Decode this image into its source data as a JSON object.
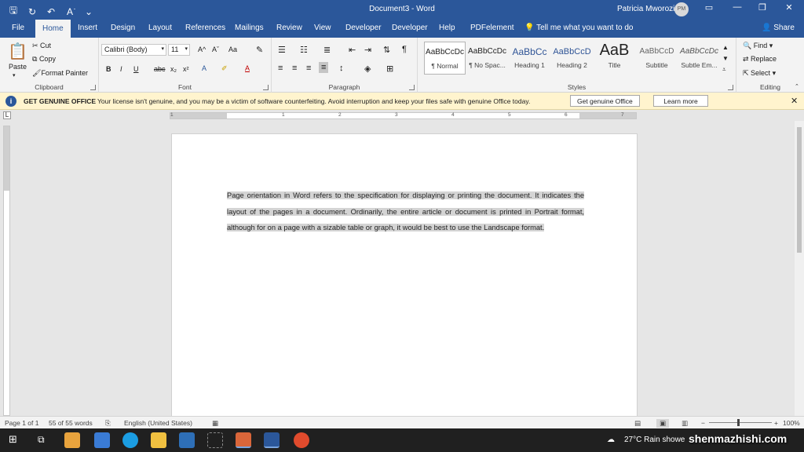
{
  "titlebar": {
    "doc_title": "Document3  -  Word",
    "user_name": "Patricia Mworozi",
    "avatar_initials": "PM"
  },
  "tabs": [
    "File",
    "Home",
    "Insert",
    "Design",
    "Layout",
    "References",
    "Mailings",
    "Review",
    "View",
    "Developer",
    "Developer",
    "Help",
    "PDFelement"
  ],
  "tell_me": "Tell me what you want to do",
  "share": "Share",
  "clipboard": {
    "label": "Clipboard",
    "paste": "Paste",
    "cut": "Cut",
    "copy": "Copy",
    "format_painter": "Format Painter"
  },
  "font": {
    "label": "Font",
    "name": "Calibri (Body)",
    "size": "11",
    "bold": "B",
    "italic": "I",
    "underline": "U",
    "strike": "abc",
    "sub": "x₂",
    "sup": "x²",
    "grow": "A^",
    "shrink": "Aˇ",
    "case": "Aa",
    "color_a": "A"
  },
  "paragraph": {
    "label": "Paragraph"
  },
  "styles": {
    "label": "Styles",
    "items": [
      {
        "preview": "AaBbCcDc",
        "name": "¶ Normal"
      },
      {
        "preview": "AaBbCcDc",
        "name": "¶ No Spac..."
      },
      {
        "preview": "AaBbCc",
        "name": "Heading 1"
      },
      {
        "preview": "AaBbCcD",
        "name": "Heading 2"
      },
      {
        "preview": "AaB",
        "name": "Title"
      },
      {
        "preview": "AaBbCcD",
        "name": "Subtitle"
      },
      {
        "preview": "AaBbCcDc",
        "name": "Subtle Em..."
      }
    ]
  },
  "editing": {
    "label": "Editing",
    "find": "Find",
    "replace": "Replace",
    "select": "Select"
  },
  "banner": {
    "title": "GET GENUINE OFFICE",
    "message": "Your license isn't genuine, and you may be a victim of software counterfeiting. Avoid interruption and keep your files safe with genuine Office today.",
    "primary_btn": "Get genuine Office",
    "secondary_btn": "Learn more"
  },
  "ruler_numbers": [
    "1",
    "1",
    "2",
    "3",
    "4",
    "5",
    "6",
    "7"
  ],
  "document": {
    "paragraph": "Page orientation in Word refers to the specification for displaying or printing the document. It indicates the layout of the pages in a document.  Ordinarily, the entire article or document is printed in Portrait format, although for on a page with a sizable table or graph, it would be best to use the Landscape format."
  },
  "status": {
    "page": "Page 1 of 1",
    "words": "55 of 55 words",
    "language": "English (United States)",
    "zoom": "100%"
  },
  "tray": {
    "weather": "27°C  Rain showe"
  },
  "watermark": "shenmazhishi.com",
  "colors": {
    "word_blue": "#2b579a",
    "banner_bg": "#fff4ce",
    "selection": "#d4d4d4"
  }
}
